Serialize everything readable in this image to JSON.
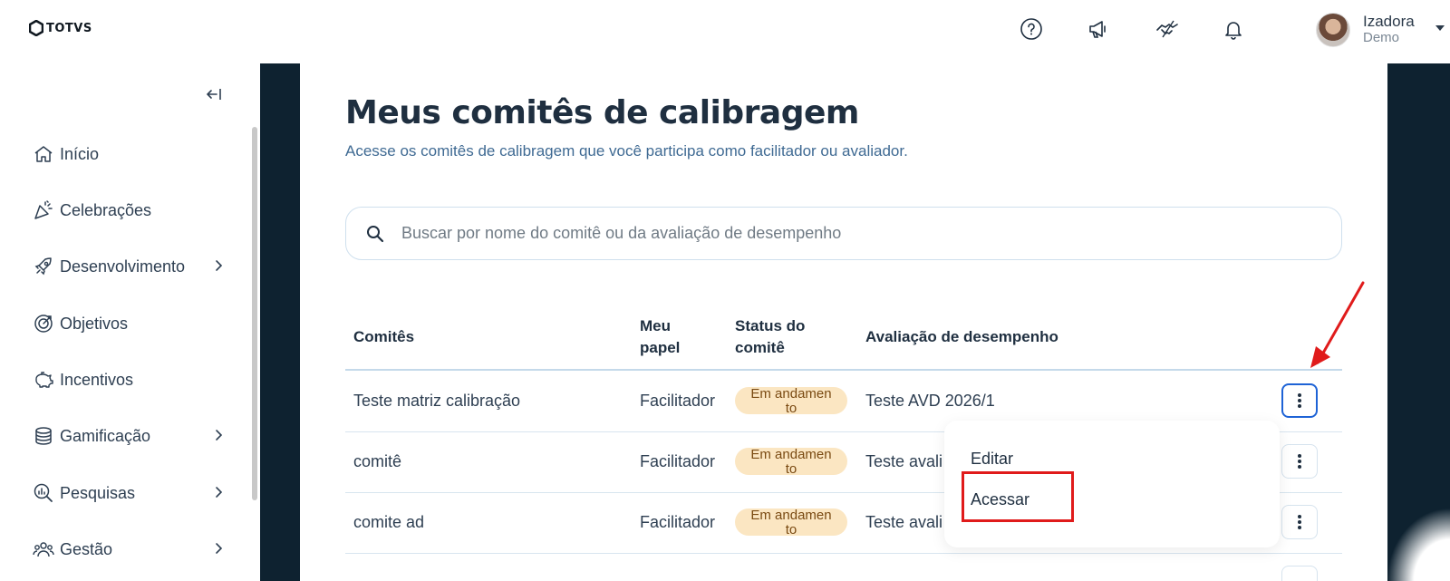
{
  "header": {
    "logo_text": "TOTVS",
    "icons": [
      "help-icon",
      "megaphone-icon",
      "handshake-icon",
      "bell-icon"
    ],
    "user": {
      "name": "Izadora",
      "role": "Demo"
    }
  },
  "sidebar": {
    "items": [
      {
        "label": "Início",
        "icon": "home-icon",
        "has_chevron": false
      },
      {
        "label": "Celebrações",
        "icon": "party-icon",
        "has_chevron": false
      },
      {
        "label": "Desenvolvimento",
        "icon": "rocket-icon",
        "has_chevron": true
      },
      {
        "label": "Objetivos",
        "icon": "target-icon",
        "has_chevron": false
      },
      {
        "label": "Incentivos",
        "icon": "piggy-bank-icon",
        "has_chevron": false
      },
      {
        "label": "Gamificação",
        "icon": "coins-icon",
        "has_chevron": true
      },
      {
        "label": "Pesquisas",
        "icon": "search-chart-icon",
        "has_chevron": true
      },
      {
        "label": "Gestão",
        "icon": "team-icon",
        "has_chevron": true
      }
    ]
  },
  "main": {
    "title": "Meus comitês de calibragem",
    "subtitle": "Acesse os comitês de calibragem que você participa como facilitador ou avaliador.",
    "search": {
      "placeholder": "Buscar por nome do comitê ou da avaliação de desempenho"
    },
    "table": {
      "headers": {
        "committees": "Comitês",
        "role_line1": "Meu",
        "role_line2": "papel",
        "status_line1": "Status do",
        "status_line2": "comitê",
        "evaluation": "Avaliação de desempenho"
      },
      "rows": [
        {
          "committee": "Teste matriz calibração",
          "role": "Facilitador",
          "status": "Em andamento",
          "evaluation": "Teste AVD 2026/1"
        },
        {
          "committee": "comitê",
          "role": "Facilitador",
          "status": "Em andamento",
          "evaluation": "Teste avali"
        },
        {
          "committee": "comite ad",
          "role": "Facilitador",
          "status": "Em andamento",
          "evaluation": "Teste avali"
        }
      ]
    },
    "menu": {
      "items": [
        "Editar",
        "Acessar"
      ]
    }
  },
  "colors": {
    "accent": "#1e63d6",
    "highlight": "#e01b1b",
    "badge_bg": "#fbe6c2",
    "backdrop": "#0e2230"
  }
}
